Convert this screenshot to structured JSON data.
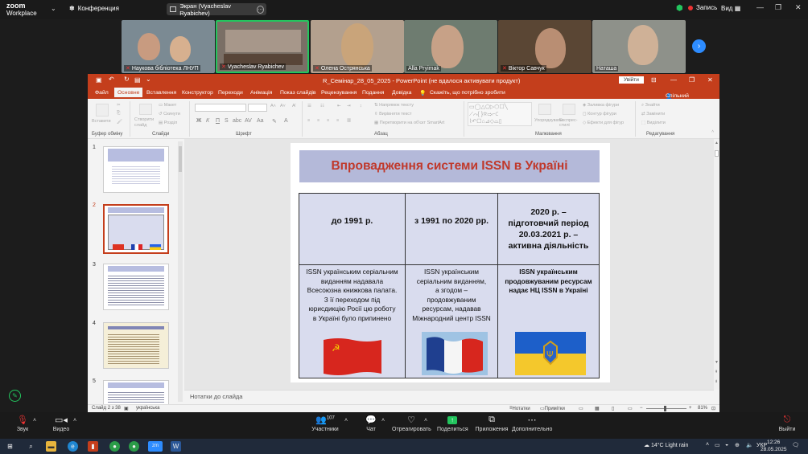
{
  "zoom": {
    "logo_line1": "zoom",
    "logo_line2": "Workplace",
    "meeting_label": "Конференция",
    "screen_share_label": "Экран (Vyacheslav Ryabichev)",
    "record_label": "Запись",
    "view_label": "Вид",
    "participants": [
      {
        "name": "Наукова бібліотека ЛНУП",
        "muted": true
      },
      {
        "name": "Vyacheslav Ryabichev",
        "muted": true
      },
      {
        "name": "Олена Острянська",
        "muted": true
      },
      {
        "name": "Alla Pryimak",
        "muted": false
      },
      {
        "name": "Віктор Савчук",
        "muted": true
      },
      {
        "name": "Наташа",
        "muted": false
      }
    ],
    "toolbar": {
      "audio": "Звук",
      "video": "Видео",
      "participants": "Участники",
      "participants_count": "107",
      "chat": "Чат",
      "react": "Отреагировать",
      "share": "Поделиться",
      "apps": "Приложения",
      "more": "Дополнительно",
      "leave": "Выйти"
    }
  },
  "powerpoint": {
    "title": "R_Семінар_28_05_2025  -  PowerPoint (не вдалося активувати продукт)",
    "login": "Увійти",
    "tabs": [
      "Файл",
      "Основне",
      "Вставлення",
      "Конструктор",
      "Переходи",
      "Анімація",
      "Показ слайдів",
      "Рецензування",
      "Подання",
      "Довідка"
    ],
    "active_tab": "Основне",
    "tell_me": "Скажіть, що потрібно зробити",
    "share": "Спільний доступ",
    "ribbon_groups": [
      "Буфер обміну",
      "Слайди",
      "Шрифт",
      "Абзац",
      "Малювання",
      "Редагування"
    ],
    "ribbon_items": {
      "paste": "Вставити",
      "new_slide": "Створити слайд",
      "section": "Розділ",
      "layout": "Макет",
      "reset": "Скинути",
      "text_direction": "Напрямок тексту",
      "align_text": "Вирівняти текст",
      "convert_smartart": "Перетворити на об'єкт SmartArt",
      "arrange": "Упорядкувати",
      "quick_styles": "Експрес-стилі",
      "shape_fill": "Заливка фігури",
      "shape_outline": "Контур фігури",
      "shape_effects": "Ефекти для фігур",
      "find": "Знайти",
      "replace": "Замінити",
      "select": "Виділити"
    },
    "thumbnail_numbers": [
      "1",
      "2",
      "3",
      "4",
      "5"
    ],
    "notes_placeholder": "Нотатки до слайда",
    "status": {
      "slide": "Слайд 2 з 38",
      "language": "українська",
      "notes": "Нотатки",
      "comments": "Примітки",
      "zoom": "81%"
    }
  },
  "slide": {
    "title": "Впровадження системи ISSN в Україні",
    "columns": [
      {
        "header": [
          "до 1991 р."
        ],
        "body": [
          "ISSN українським серіальним",
          "виданням надавала",
          "Всесоюзна книжкова палата.",
          "З її переходом під",
          "юрисдикцію Росії цю роботу",
          "в Україні було припинено"
        ],
        "flag": "ussr-flag"
      },
      {
        "header": [
          "з 1991 по 2020 рр."
        ],
        "body": [
          "ISSN українським",
          "серіальним виданням,",
          "а згодом –",
          "продовжуваним",
          "ресурсам, надавав",
          "Міжнародний центр ISSN"
        ],
        "flag": "france-flag"
      },
      {
        "header": [
          "2020 р. –",
          "підготовчий період",
          "20.03.2021 р. –",
          "активна діяльність"
        ],
        "body": [
          "ISSN українським",
          "продовжуваним ресурсам",
          "надає НЦ ISSN в Україні"
        ],
        "flag": "ukraine-flag"
      }
    ]
  },
  "taskbar": {
    "weather": "14°C  Light rain",
    "language": "УКР",
    "time": "12:26",
    "date": "28.05.2025"
  },
  "colors": {
    "ppt_accent": "#c43e1c",
    "zoom_blue": "#2d8cff",
    "slide_title": "#c0392b",
    "slide_title_bg": "#b4b9d9",
    "table_bg": "#d9dcee"
  }
}
